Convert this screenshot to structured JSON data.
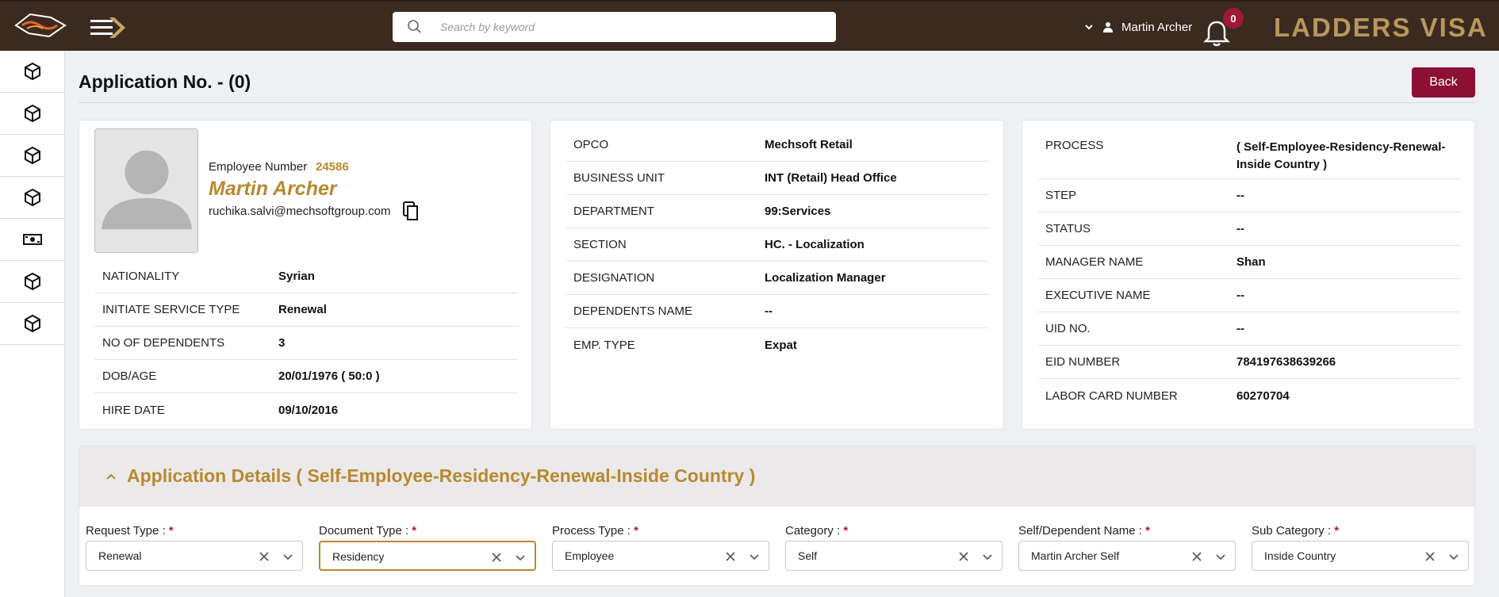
{
  "header": {
    "search_placeholder": "Search by keyword",
    "user_name": "Martin Archer",
    "notification_count": "0",
    "brand": "LADDERS VISA"
  },
  "page": {
    "title": "Application No. - (0)",
    "back_label": "Back"
  },
  "employee": {
    "number_label": "Employee Number",
    "number": "24586",
    "name": "Martin Archer",
    "email": "ruchika.salvi@mechsoftgroup.com"
  },
  "card1_rows": [
    {
      "key": "NATIONALITY",
      "value": "Syrian"
    },
    {
      "key": "INITIATE SERVICE TYPE",
      "value": "Renewal"
    },
    {
      "key": "NO OF DEPENDENTS",
      "value": "3"
    },
    {
      "key": "DOB/AGE",
      "value": "20/01/1976 ( 50:0 )"
    },
    {
      "key": "HIRE DATE",
      "value": "09/10/2016"
    }
  ],
  "card2_rows": [
    {
      "key": "OPCO",
      "value": "Mechsoft Retail"
    },
    {
      "key": "BUSINESS UNIT",
      "value": "INT (Retail) Head Office"
    },
    {
      "key": "DEPARTMENT",
      "value": "99:Services"
    },
    {
      "key": "SECTION",
      "value": "HC. - Localization"
    },
    {
      "key": "DESIGNATION",
      "value": "Localization Manager"
    },
    {
      "key": "DEPENDENTS NAME",
      "value": "--"
    },
    {
      "key": "EMP. TYPE",
      "value": "Expat"
    }
  ],
  "card3_rows": [
    {
      "key": "PROCESS",
      "value_line1": "( Self-Employee-Residency-Renewal-",
      "value_line2": "Inside Country )"
    },
    {
      "key": "STEP",
      "value": "--"
    },
    {
      "key": "STATUS",
      "value": "--"
    },
    {
      "key": "MANAGER NAME",
      "value": "Shan"
    },
    {
      "key": "EXECUTIVE NAME",
      "value": "--"
    },
    {
      "key": "UID NO.",
      "value": "--"
    },
    {
      "key": "EID NUMBER",
      "value": "784197638639266"
    },
    {
      "key": "LABOR CARD NUMBER",
      "value": "60270704"
    }
  ],
  "application": {
    "title": "Application Details ( Self-Employee-Residency-Renewal-Inside Country )",
    "fields": [
      {
        "label": "Request Type :",
        "value": "Renewal"
      },
      {
        "label": "Document Type :",
        "value": "Residency"
      },
      {
        "label": "Process Type :",
        "value": "Employee"
      },
      {
        "label": "Category :",
        "value": "Self"
      },
      {
        "label": "Self/Dependent Name :",
        "value": "Martin Archer Self"
      },
      {
        "label": "Sub Category :",
        "value": "Inside Country"
      }
    ],
    "required_mark": "*"
  },
  "colors": {
    "topbar": "#3b2a20",
    "brand_gold": "#b8975c",
    "accent_gold": "#b8892e",
    "back_button": "#8c1034",
    "badge": "#a01834"
  }
}
